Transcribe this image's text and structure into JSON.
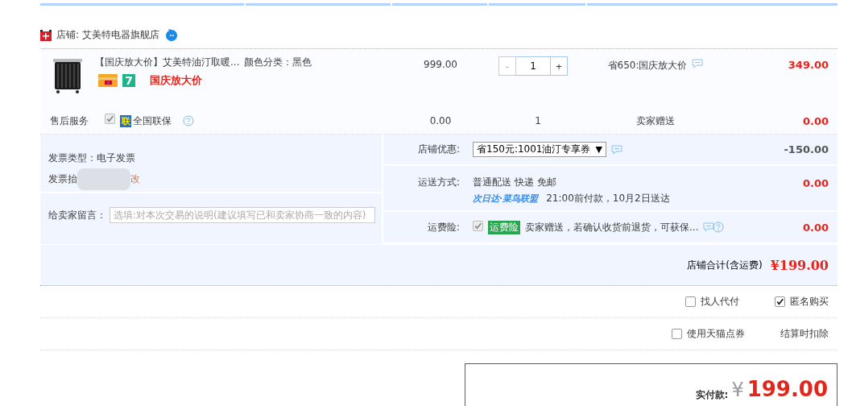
{
  "store": {
    "name": "店铺: 艾美特电器旗舰店"
  },
  "item": {
    "title": "【国庆放大价】艾美特油汀取暖...",
    "sku": "颜色分类：黑色",
    "badge": "7",
    "promo": "国庆放大价",
    "price": "999.00",
    "minus": "-",
    "quantity": "1",
    "plus": "+",
    "discount": "省650:国庆放大价",
    "subtotal": "349.00"
  },
  "service": {
    "label": "售后服务",
    "checked": true,
    "badge": "联",
    "name": "全国联保",
    "price": "0.00",
    "quantity": "1",
    "note": "卖家赠送",
    "subtotal": "0.00"
  },
  "invoice": {
    "type": "发票类型：电子发票",
    "title_prefix": "发票抬",
    "edit_link": "改"
  },
  "message": {
    "label": "给卖家留言：",
    "placeholder": "选填:对本次交易的说明(建议填写已和卖家协商一致的内容)"
  },
  "store_discount": {
    "label": "店铺优惠:",
    "value": "省150元:1001油汀专享券",
    "arrow": "▼",
    "amount": "-150.00"
  },
  "shipping": {
    "label": "运送方式:",
    "method": "普通配送 快递 免邮",
    "carrier": "次日达·菜鸟联盟",
    "eta": "21:00前付款，10月2日送达",
    "amount": "0.00"
  },
  "insurance": {
    "label": "运费险:",
    "checked": true,
    "tag": "运费险",
    "text": "卖家赠送，若确认收货前退货，可获保...",
    "amount": "0.00"
  },
  "store_total": {
    "label": "店铺合计(含运费)",
    "amount": "¥199.00"
  },
  "options": [
    {
      "label": "找人代付",
      "checked": false
    },
    {
      "label": "匿名购买",
      "checked": true
    }
  ],
  "points": {
    "label": "使用天猫点券",
    "checked": false,
    "note": "结算时扣除"
  },
  "payment": {
    "label": "实付款:",
    "currency": "¥",
    "amount": "199.00"
  }
}
